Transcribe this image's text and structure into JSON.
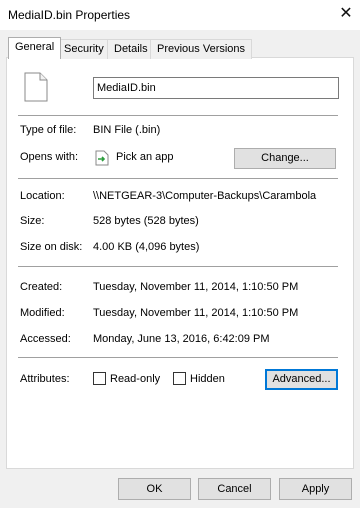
{
  "window": {
    "title": "MediaID.bin Properties",
    "close_glyph": "✕"
  },
  "tabs": [
    {
      "label": "General",
      "active": true
    },
    {
      "label": "Security",
      "active": false
    },
    {
      "label": "Details",
      "active": false
    },
    {
      "label": "Previous Versions",
      "active": false
    }
  ],
  "general": {
    "file_icon": "generic-file-icon",
    "filename": "MediaID.bin",
    "type_of_file": {
      "label": "Type of file:",
      "value": "BIN File (.bin)"
    },
    "opens_with": {
      "label": "Opens with:",
      "app_icon": "pick-app-icon",
      "value": "Pick an app",
      "change_label": "Change..."
    },
    "location": {
      "label": "Location:",
      "value": "\\\\NETGEAR-3\\Computer-Backups\\Carambola"
    },
    "size": {
      "label": "Size:",
      "value": "528 bytes (528 bytes)"
    },
    "size_on_disk": {
      "label": "Size on disk:",
      "value": "4.00 KB (4,096 bytes)"
    },
    "created": {
      "label": "Created:",
      "value": "Tuesday, November 11, 2014, 1:10:50 PM"
    },
    "modified": {
      "label": "Modified:",
      "value": "Tuesday, November 11, 2014, 1:10:50 PM"
    },
    "accessed": {
      "label": "Accessed:",
      "value": "Monday, June 13, 2016, 6:42:09 PM"
    },
    "attributes": {
      "label": "Attributes:",
      "read_only": {
        "label": "Read-only",
        "checked": false
      },
      "hidden": {
        "label": "Hidden",
        "checked": false
      },
      "advanced_label": "Advanced..."
    }
  },
  "footer": {
    "ok_label": "OK",
    "cancel_label": "Cancel",
    "apply_label": "Apply"
  },
  "colors": {
    "accent": "#0078d7",
    "button_bg": "#e1e1e1",
    "panel_bg": "#ffffff",
    "dialog_bg": "#f0f0f0"
  }
}
